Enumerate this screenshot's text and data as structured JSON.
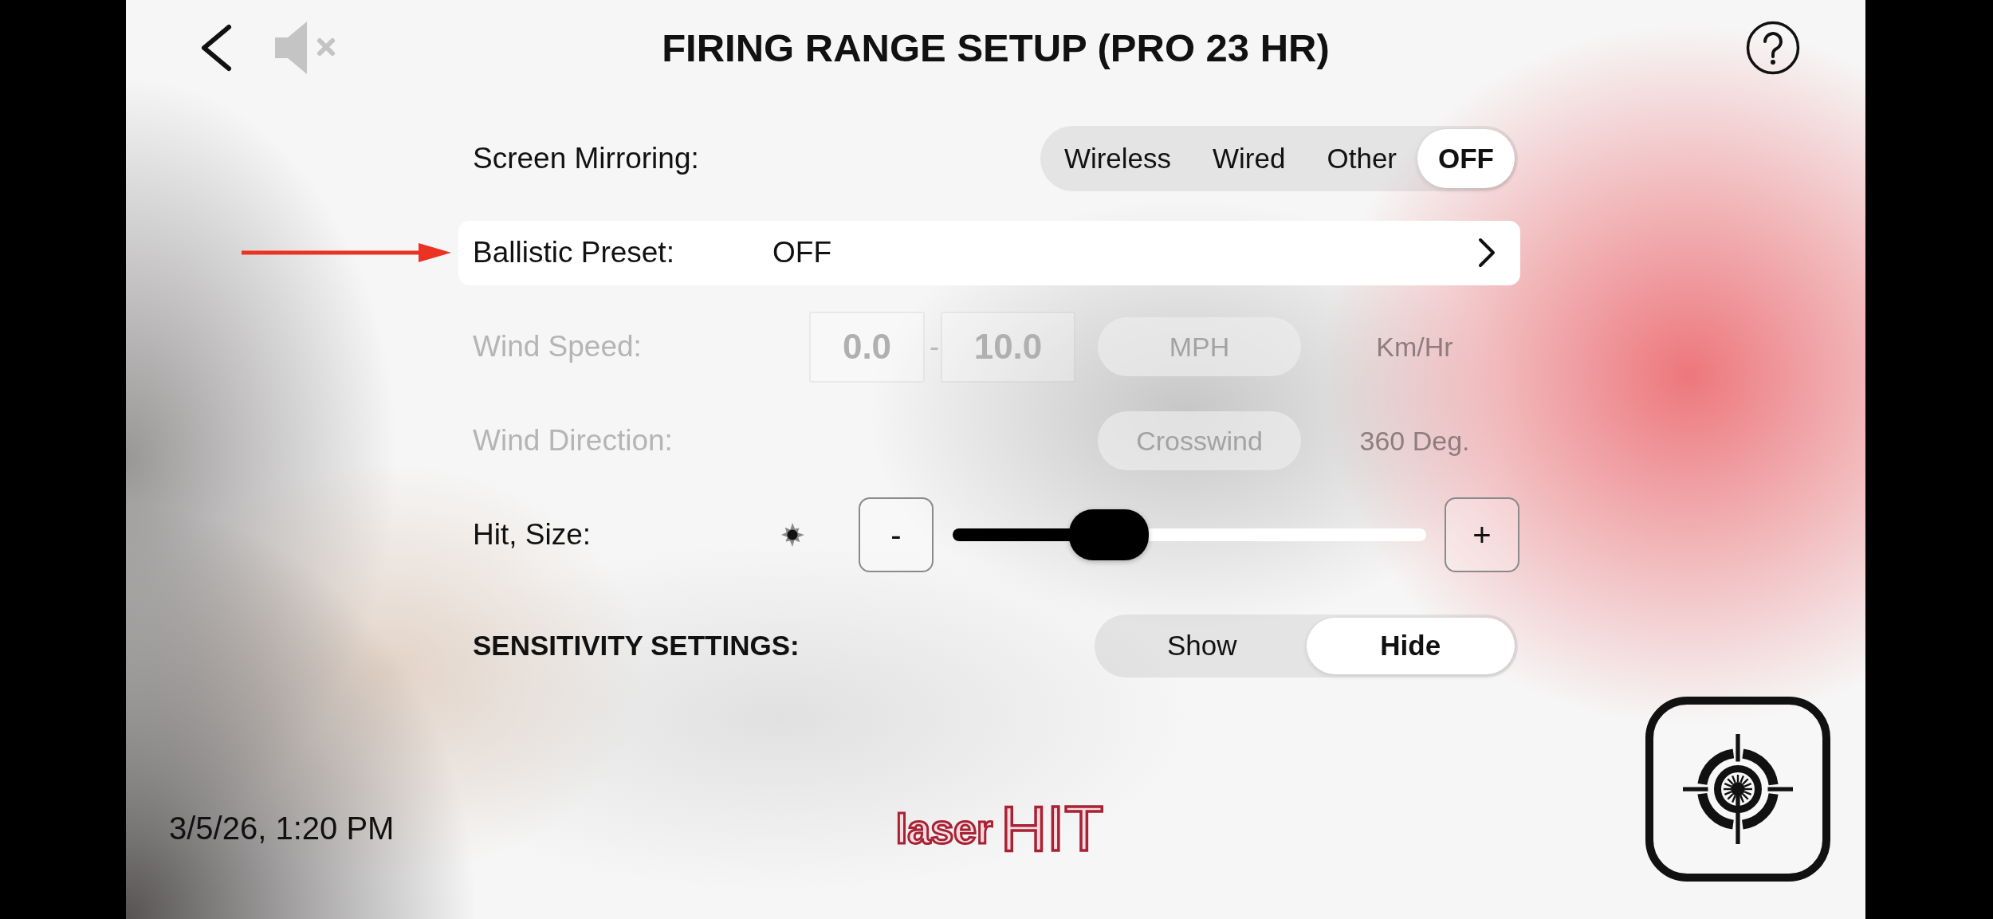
{
  "header": {
    "title": "FIRING RANGE SETUP (PRO 23 HR)"
  },
  "settings": [
    {
      "kind": "segmented",
      "label": "Screen Mirroring:",
      "disabled": false,
      "options": [
        {
          "label": "Wireless",
          "selected": false
        },
        {
          "label": "Wired",
          "selected": false
        },
        {
          "label": "Other",
          "selected": false
        },
        {
          "label": "OFF",
          "selected": true
        }
      ]
    },
    {
      "kind": "link",
      "label": "Ballistic Preset:",
      "disabled": false,
      "annotated": true,
      "value": "OFF"
    },
    {
      "kind": "range",
      "label": "Wind Speed:",
      "disabled": true,
      "from": "0.0",
      "separator": "-",
      "to": "10.0",
      "options": [
        {
          "label": "MPH",
          "selected": true
        },
        {
          "label": "Km/Hr",
          "selected": false
        }
      ]
    },
    {
      "kind": "choice",
      "label": "Wind Direction:",
      "disabled": true,
      "options": [
        {
          "label": "Crosswind",
          "selected": true
        },
        {
          "label": "360 Deg.",
          "selected": false
        }
      ]
    },
    {
      "kind": "slider",
      "label": "Hit, Size:",
      "disabled": false,
      "decrease": "-",
      "increase": "+",
      "level": 0.33
    },
    {
      "kind": "toggle",
      "label": "SENSITIVITY SETTINGS:",
      "disabled": false,
      "options": [
        {
          "label": "Show",
          "selected": false
        },
        {
          "label": "Hide",
          "selected": true
        }
      ]
    }
  ],
  "footer": {
    "datetime": "3/5/26, 1:20 PM",
    "logo": {
      "prefix": "laser",
      "main": "HIT"
    }
  }
}
